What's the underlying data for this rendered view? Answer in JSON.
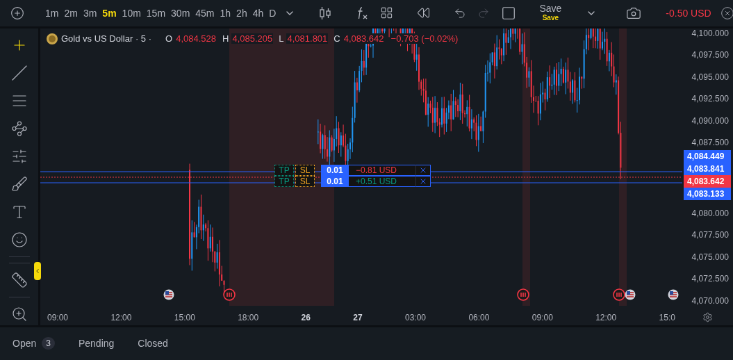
{
  "toolbar": {
    "timeframes": [
      {
        "label": "1m",
        "selected": false
      },
      {
        "label": "2m",
        "selected": false
      },
      {
        "label": "3m",
        "selected": false
      },
      {
        "label": "5m",
        "selected": true
      },
      {
        "label": "10m",
        "selected": false
      },
      {
        "label": "15m",
        "selected": false
      },
      {
        "label": "30m",
        "selected": false
      },
      {
        "label": "45m",
        "selected": false
      },
      {
        "label": "1h",
        "selected": false
      },
      {
        "label": "2h",
        "selected": false
      },
      {
        "label": "4h",
        "selected": false
      },
      {
        "label": "D",
        "selected": false
      }
    ],
    "save": {
      "label": "Save",
      "sublabel": "Save"
    },
    "pnl": "-0.50 USD"
  },
  "drawing_tools": [
    {
      "selected": true
    },
    {
      "selected": false
    },
    {
      "selected": false
    },
    {
      "selected": false
    },
    {
      "selected": false
    },
    {
      "selected": false
    },
    {
      "selected": false
    },
    {
      "selected": false
    },
    {
      "selected": false
    },
    {
      "selected": false
    }
  ],
  "legend": {
    "symbol": "Gold vs US Dollar · 5 ·",
    "ohlc": [
      {
        "label": "O",
        "value": "4,084.528"
      },
      {
        "label": "H",
        "value": "4,085.205"
      },
      {
        "label": "L",
        "value": "4,081.801"
      },
      {
        "label": "C",
        "value": "4,083.642"
      }
    ],
    "change": "−0.703 (−0.02%)"
  },
  "orders": [
    {
      "tp": "TP",
      "sl": "SL",
      "qty": "0.01",
      "pnl": "−0.81 USD",
      "kind": "loss"
    },
    {
      "tp": "TP",
      "sl": "SL",
      "qty": "0.01",
      "pnl": "+0.51 USD",
      "kind": "profit"
    }
  ],
  "price_axis": [
    "4,100.000",
    "4,097.500",
    "4,095.000",
    "4,092.500",
    "4,090.000",
    "4,087.500",
    "4,080.000",
    "4,077.500",
    "4,075.000",
    "4,072.500",
    "4,070.000"
  ],
  "price_tags": [
    {
      "text": "4,084.449",
      "color": "#2962ff"
    },
    {
      "text": "4,083.841",
      "color": "#2962ff"
    },
    {
      "text": "4,083.642",
      "color": "#f23645"
    },
    {
      "text": "4,083.133",
      "color": "#2962ff"
    }
  ],
  "time_axis": [
    {
      "label": "09:00",
      "kind": "time"
    },
    {
      "label": "12:00",
      "kind": "time"
    },
    {
      "label": "15:00",
      "kind": "time"
    },
    {
      "label": "18:00",
      "kind": "time"
    },
    {
      "label": "26",
      "kind": "day"
    },
    {
      "label": "27",
      "kind": "day"
    },
    {
      "label": "03:00",
      "kind": "time"
    },
    {
      "label": "06:00",
      "kind": "time"
    },
    {
      "label": "09:00",
      "kind": "time"
    },
    {
      "label": "12:00",
      "kind": "time"
    },
    {
      "label": "15:0",
      "kind": "time"
    }
  ],
  "bottom_tabs": [
    {
      "label": "Open",
      "count": "3",
      "selected": false
    },
    {
      "label": "Pending",
      "selected": false
    },
    {
      "label": "Closed",
      "selected": false
    }
  ]
}
